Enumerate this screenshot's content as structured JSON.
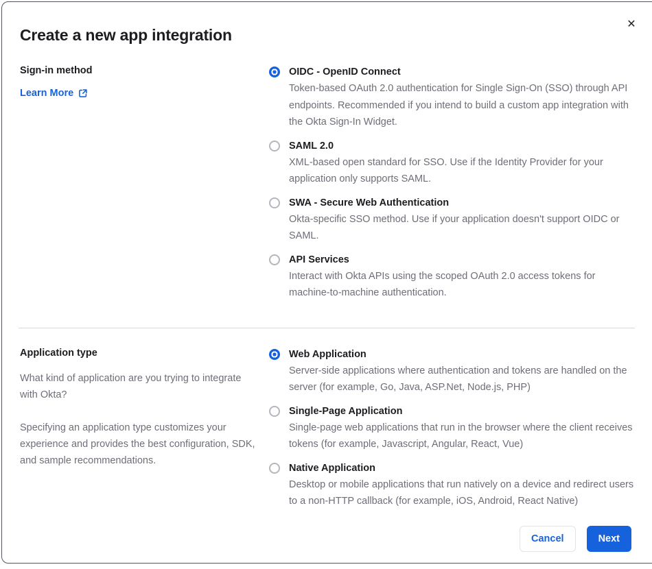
{
  "modal": {
    "title": "Create a new app integration",
    "close_icon": "✕"
  },
  "colors": {
    "accent_blue": "#1662dd",
    "text_dark": "#1d1d21",
    "text_muted": "#6e6e78",
    "divider": "#d7d7dc",
    "modal_border": "#54545c"
  },
  "sections": [
    {
      "heading": "Sign-in method",
      "learn_more_label": "Learn More",
      "options": [
        {
          "label": "OIDC - OpenID Connect",
          "description": "Token-based OAuth 2.0 authentication for Single Sign-On (SSO) through API endpoints. Recommended if you intend to build a custom app integration with the Okta Sign-In Widget.",
          "selected": true
        },
        {
          "label": "SAML 2.0",
          "description": "XML-based open standard for SSO. Use if the Identity Provider for your application only supports SAML.",
          "selected": false
        },
        {
          "label": "SWA - Secure Web Authentication",
          "description": "Okta-specific SSO method. Use if your application doesn't support OIDC or SAML.",
          "selected": false
        },
        {
          "label": "API Services",
          "description": "Interact with Okta APIs using the scoped OAuth 2.0 access tokens for machine-to-machine authentication.",
          "selected": false
        }
      ]
    },
    {
      "heading": "Application type",
      "paragraphs": [
        "What kind of application are you trying to integrate with Okta?",
        "Specifying an application type customizes your experience and provides the best configuration, SDK, and sample recommendations."
      ],
      "options": [
        {
          "label": "Web Application",
          "description": "Server-side applications where authentication and tokens are handled on the server (for example, Go, Java, ASP.Net, Node.js, PHP)",
          "selected": true
        },
        {
          "label": "Single-Page Application",
          "description": "Single-page web applications that run in the browser where the client receives tokens (for example, Javascript, Angular, React, Vue)",
          "selected": false
        },
        {
          "label": "Native Application",
          "description": "Desktop or mobile applications that run natively on a device and redirect users to a non-HTTP callback (for example, iOS, Android, React Native)",
          "selected": false
        }
      ]
    }
  ],
  "footer": {
    "cancel_label": "Cancel",
    "next_label": "Next"
  }
}
